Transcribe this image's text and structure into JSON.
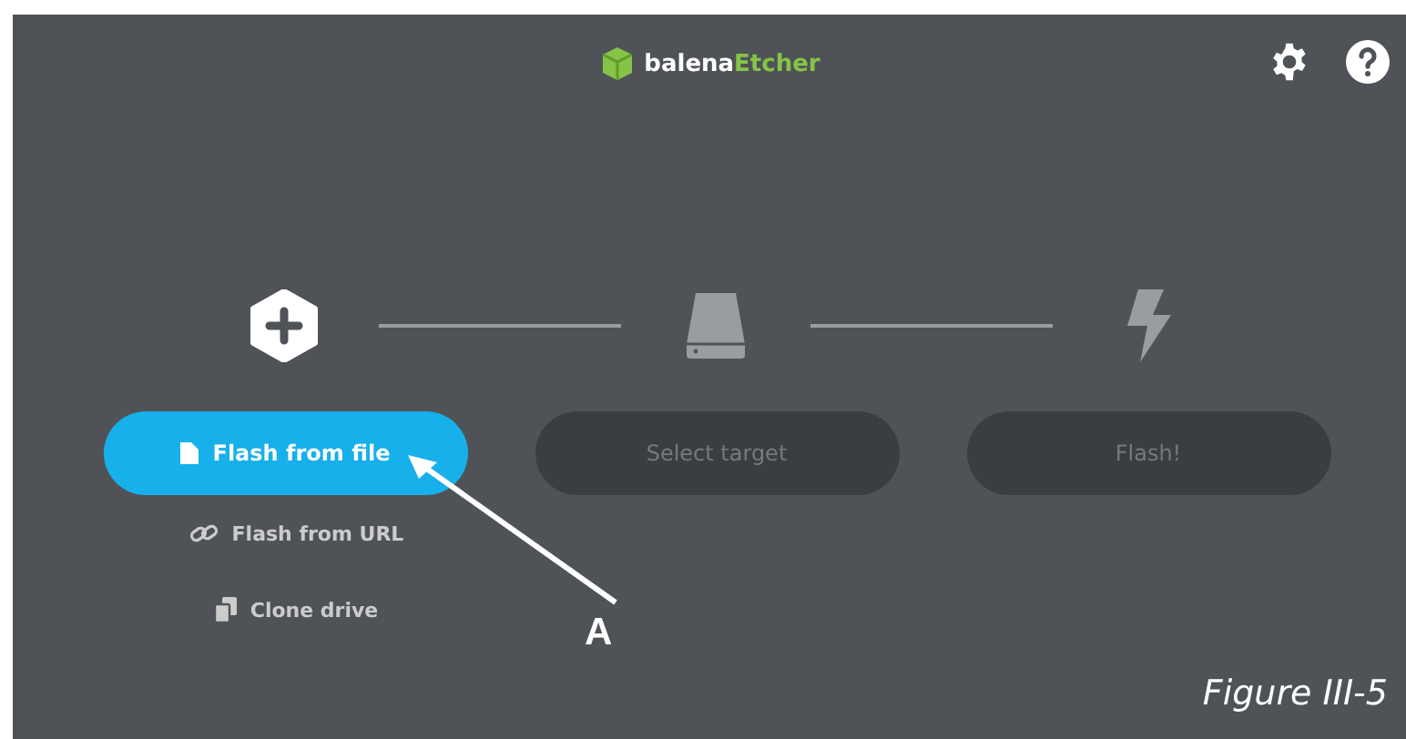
{
  "header": {
    "logo": {
      "brand": "balena",
      "product": "Etcher"
    }
  },
  "steps": [
    {
      "kind": "source",
      "button": {
        "label": "Flash from file",
        "disabled": false
      }
    },
    {
      "kind": "target",
      "button": {
        "label": "Select target",
        "disabled": true
      }
    },
    {
      "kind": "flash",
      "button": {
        "label": "Flash!",
        "disabled": true
      }
    }
  ],
  "source_options": [
    {
      "kind": "url",
      "label": "Flash from URL"
    },
    {
      "kind": "clone",
      "label": "Clone drive"
    }
  ],
  "annotation": {
    "label": "A"
  },
  "caption": "Figure III-5"
}
